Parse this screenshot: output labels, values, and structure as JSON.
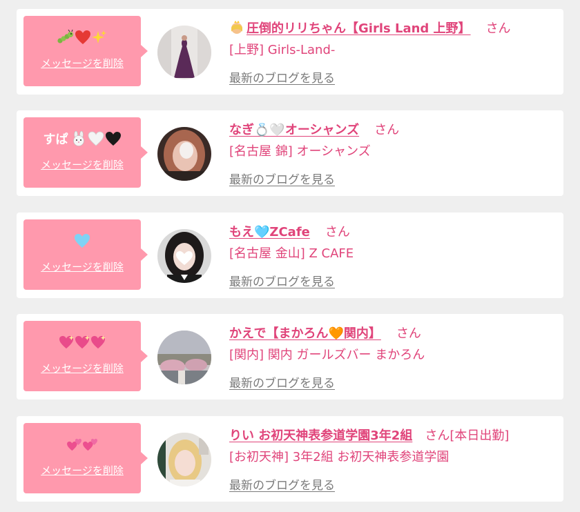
{
  "colors": {
    "page_bg": "#efefef",
    "card_bg": "#ffffff",
    "message_box": "#ff99ad",
    "name_pink": "#e0447a",
    "blog_gray": "#7a7a7a"
  },
  "labels": {
    "delete_message": "メッセージを削除",
    "view_latest_blog": "最新のブログを見る",
    "honorific": "さん"
  },
  "cards": [
    {
      "message_text": "",
      "message_icons": [
        "caterpillar-icon",
        "red-heart-icon",
        "sparkles-icon"
      ],
      "name_icon": "princess-icon",
      "name": "圧倒的リリちゃん【Girls Land 上野】",
      "shop": "[上野] Girls-Land-",
      "extra": ""
    },
    {
      "message_text": "すぱ",
      "message_icons": [
        "rabbit-icon",
        "white-heart-icon",
        "black-heart-icon"
      ],
      "name_icon": "",
      "name": "なぎ💍🤍オーシャンズ",
      "shop": "[名古屋 錦] オーシャンズ",
      "extra": ""
    },
    {
      "message_text": "",
      "message_icons": [
        "light-blue-heart-icon"
      ],
      "name_icon": "",
      "name": "もえ🩵ZCafe",
      "shop": "[名古屋 金山] Z CAFE",
      "extra": ""
    },
    {
      "message_text": "",
      "message_icons": [
        "sparkling-heart-icon",
        "sparkling-heart-icon",
        "sparkling-heart-icon"
      ],
      "name_icon": "",
      "name": "かえで【まかろん🧡関内】",
      "shop": "[関内] 関内 ガールズバー まかろん",
      "extra": ""
    },
    {
      "message_text": "",
      "message_icons": [
        "two-hearts-icon",
        "two-hearts-icon"
      ],
      "name_icon": "",
      "name": "りい お初天神表参道学園3年2組",
      "shop": "[お初天神] 3年2組 お初天神表参道学園",
      "extra": "[本日出勤]"
    }
  ]
}
